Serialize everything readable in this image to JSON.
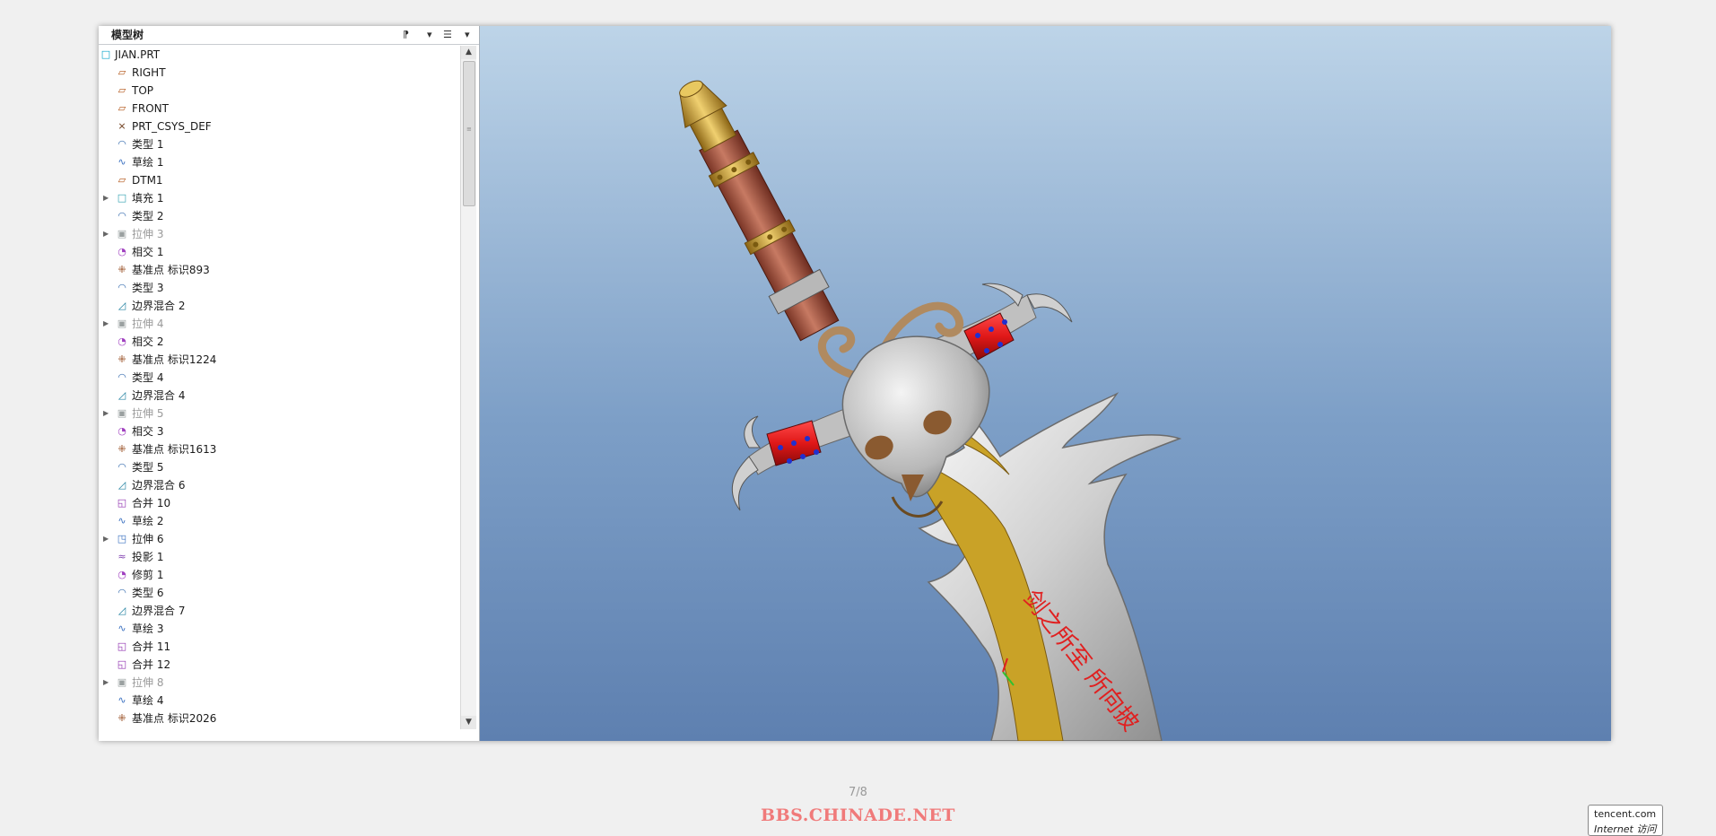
{
  "model_tree": {
    "title": "模型树",
    "header_buttons": [
      {
        "icon": "tree-filter-icon",
        "glyph": "⁋"
      },
      {
        "icon": "dropdown-arrow-icon",
        "glyph": "▾"
      },
      {
        "icon": "list-settings-icon",
        "glyph": "☰"
      },
      {
        "icon": "dropdown-arrow-icon",
        "glyph": "▾"
      }
    ],
    "items": [
      {
        "label": "JIAN.PRT",
        "icon": "part-icon",
        "glyph": "□",
        "cls": "i-part",
        "level": 0,
        "expandable": false,
        "suppressed": false
      },
      {
        "label": "RIGHT",
        "icon": "datum-plane-icon",
        "glyph": "▱",
        "cls": "i-plane",
        "level": 1,
        "expandable": false,
        "suppressed": false
      },
      {
        "label": "TOP",
        "icon": "datum-plane-icon",
        "glyph": "▱",
        "cls": "i-plane",
        "level": 1,
        "expandable": false,
        "suppressed": false
      },
      {
        "label": "FRONT",
        "icon": "datum-plane-icon",
        "glyph": "▱",
        "cls": "i-plane",
        "level": 1,
        "expandable": false,
        "suppressed": false
      },
      {
        "label": "PRT_CSYS_DEF",
        "icon": "coordinate-system-icon",
        "glyph": "⨯",
        "cls": "i-csys",
        "level": 1,
        "expandable": false,
        "suppressed": false
      },
      {
        "label": "类型 1",
        "icon": "surface-icon",
        "glyph": "◠",
        "cls": "i-surf",
        "level": 1,
        "expandable": false,
        "suppressed": false
      },
      {
        "label": "草绘 1",
        "icon": "sketch-icon",
        "glyph": "∿",
        "cls": "i-sketch",
        "level": 1,
        "expandable": false,
        "suppressed": false
      },
      {
        "label": "DTM1",
        "icon": "datum-plane-icon",
        "glyph": "▱",
        "cls": "i-plane",
        "level": 1,
        "expandable": false,
        "suppressed": false
      },
      {
        "label": "填充 1",
        "icon": "fill-icon",
        "glyph": "□",
        "cls": "i-fill",
        "level": 1,
        "expandable": true,
        "suppressed": false
      },
      {
        "label": "类型 2",
        "icon": "surface-icon",
        "glyph": "◠",
        "cls": "i-surf",
        "level": 1,
        "expandable": false,
        "suppressed": false
      },
      {
        "label": "拉伸 3",
        "icon": "extrude-icon",
        "glyph": "▣",
        "cls": "i-extr",
        "level": 1,
        "expandable": true,
        "suppressed": true
      },
      {
        "label": "相交 1",
        "icon": "intersect-icon",
        "glyph": "◔",
        "cls": "i-inter",
        "level": 1,
        "expandable": false,
        "suppressed": false
      },
      {
        "label": "基准点 标识893",
        "icon": "datum-point-icon",
        "glyph": "⁜",
        "cls": "i-point",
        "level": 1,
        "expandable": false,
        "suppressed": false
      },
      {
        "label": "类型 3",
        "icon": "surface-icon",
        "glyph": "◠",
        "cls": "i-surf",
        "level": 1,
        "expandable": false,
        "suppressed": false
      },
      {
        "label": "边界混合 2",
        "icon": "boundary-blend-icon",
        "glyph": "◿",
        "cls": "i-blend",
        "level": 1,
        "expandable": false,
        "suppressed": false
      },
      {
        "label": "拉伸 4",
        "icon": "extrude-icon",
        "glyph": "▣",
        "cls": "i-extr",
        "level": 1,
        "expandable": true,
        "suppressed": true
      },
      {
        "label": "相交 2",
        "icon": "intersect-icon",
        "glyph": "◔",
        "cls": "i-inter",
        "level": 1,
        "expandable": false,
        "suppressed": false
      },
      {
        "label": "基准点 标识1224",
        "icon": "datum-point-icon",
        "glyph": "⁜",
        "cls": "i-point",
        "level": 1,
        "expandable": false,
        "suppressed": false
      },
      {
        "label": "类型 4",
        "icon": "surface-icon",
        "glyph": "◠",
        "cls": "i-surf",
        "level": 1,
        "expandable": false,
        "suppressed": false
      },
      {
        "label": "边界混合 4",
        "icon": "boundary-blend-icon",
        "glyph": "◿",
        "cls": "i-blend",
        "level": 1,
        "expandable": false,
        "suppressed": false
      },
      {
        "label": "拉伸 5",
        "icon": "extrude-icon",
        "glyph": "▣",
        "cls": "i-extr",
        "level": 1,
        "expandable": true,
        "suppressed": true
      },
      {
        "label": "相交 3",
        "icon": "intersect-icon",
        "glyph": "◔",
        "cls": "i-inter",
        "level": 1,
        "expandable": false,
        "suppressed": false
      },
      {
        "label": "基准点 标识1613",
        "icon": "datum-point-icon",
        "glyph": "⁜",
        "cls": "i-point",
        "level": 1,
        "expandable": false,
        "suppressed": false
      },
      {
        "label": "类型 5",
        "icon": "surface-icon",
        "glyph": "◠",
        "cls": "i-surf",
        "level": 1,
        "expandable": false,
        "suppressed": false
      },
      {
        "label": "边界混合 6",
        "icon": "boundary-blend-icon",
        "glyph": "◿",
        "cls": "i-blend",
        "level": 1,
        "expandable": false,
        "suppressed": false
      },
      {
        "label": "合并 10",
        "icon": "merge-icon",
        "glyph": "◱",
        "cls": "i-merge",
        "level": 1,
        "expandable": false,
        "suppressed": false
      },
      {
        "label": "草绘 2",
        "icon": "sketch-icon",
        "glyph": "∿",
        "cls": "i-sketch",
        "level": 1,
        "expandable": false,
        "suppressed": false
      },
      {
        "label": "拉伸 6",
        "icon": "extrude-icon",
        "glyph": "◳",
        "cls": "i-sketch",
        "level": 1,
        "expandable": true,
        "suppressed": false
      },
      {
        "label": "投影 1",
        "icon": "projection-icon",
        "glyph": "≈",
        "cls": "i-proj",
        "level": 1,
        "expandable": false,
        "suppressed": false
      },
      {
        "label": "修剪 1",
        "icon": "trim-icon",
        "glyph": "◔",
        "cls": "i-trim",
        "level": 1,
        "expandable": false,
        "suppressed": false
      },
      {
        "label": "类型 6",
        "icon": "surface-icon",
        "glyph": "◠",
        "cls": "i-surf",
        "level": 1,
        "expandable": false,
        "suppressed": false
      },
      {
        "label": "边界混合 7",
        "icon": "boundary-blend-icon",
        "glyph": "◿",
        "cls": "i-blend",
        "level": 1,
        "expandable": false,
        "suppressed": false
      },
      {
        "label": "草绘 3",
        "icon": "sketch-icon",
        "glyph": "∿",
        "cls": "i-sketch",
        "level": 1,
        "expandable": false,
        "suppressed": false
      },
      {
        "label": "合并 11",
        "icon": "merge-icon",
        "glyph": "◱",
        "cls": "i-merge",
        "level": 1,
        "expandable": false,
        "suppressed": false
      },
      {
        "label": "合并 12",
        "icon": "merge-icon",
        "glyph": "◱",
        "cls": "i-merge",
        "level": 1,
        "expandable": false,
        "suppressed": false
      },
      {
        "label": "拉伸 8",
        "icon": "extrude-icon",
        "glyph": "▣",
        "cls": "i-extr",
        "level": 1,
        "expandable": true,
        "suppressed": true
      },
      {
        "label": "草绘 4",
        "icon": "sketch-icon",
        "glyph": "∿",
        "cls": "i-sketch",
        "level": 1,
        "expandable": false,
        "suppressed": false
      },
      {
        "label": "基准点 标识2026",
        "icon": "datum-point-icon",
        "glyph": "⁜",
        "cls": "i-point",
        "level": 1,
        "expandable": false,
        "suppressed": false
      }
    ]
  },
  "scrollbar": {
    "up_glyph": "▲",
    "down_glyph": "▼",
    "grip_glyph": "≡"
  },
  "viewport": {
    "blade_inscription": "剑之所至 所向披",
    "colors": {
      "bg_top": "#bdd4e8",
      "bg_bottom": "#5e80b0",
      "gold": "#c9a227",
      "handle": "#b5614c",
      "wrap_red": "#e01818",
      "rivet_blue": "#2030d0",
      "bone": "#c8c8c8",
      "inscription": "#e02020"
    }
  },
  "footer": {
    "page_counter": "7/8",
    "watermark": "BBS.CHINADE.NET"
  },
  "tooltip": {
    "line1": "tencent.com",
    "line2": "Internet 访问"
  }
}
